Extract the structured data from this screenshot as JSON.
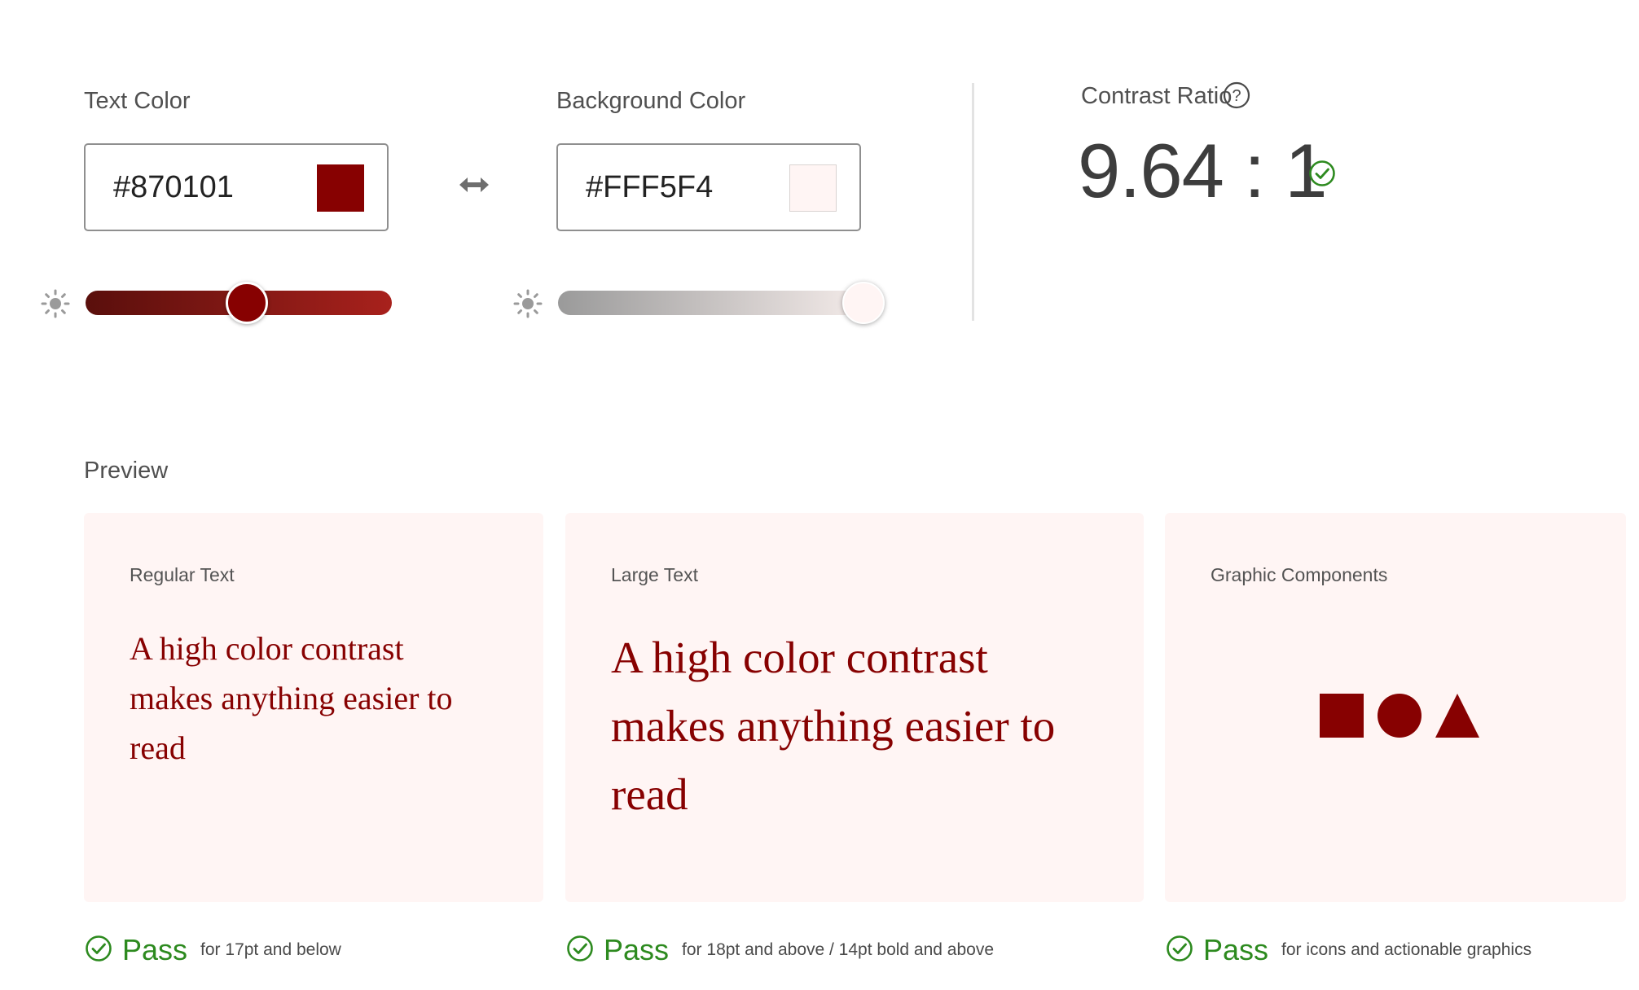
{
  "colors": {
    "text": "#870101",
    "background": "#FFF5F4",
    "pass_green": "#2d8a1f",
    "text_slider_gradient": [
      "#5a0f0c",
      "#a8211c"
    ],
    "bg_slider_gradient": [
      "#9a9a9a",
      "#f7eeec"
    ]
  },
  "text_color": {
    "label": "Text Color",
    "value": "#870101",
    "icon": "brightness-icon",
    "slider_level": 0.53
  },
  "swap": {
    "icon": "swap-arrows-icon"
  },
  "background_color": {
    "label": "Background Color",
    "value": "#FFF5F4",
    "icon": "brightness-icon",
    "slider_level": 1.0
  },
  "contrast": {
    "label": "Contrast Ratio",
    "help_icon": "help-icon",
    "value": "9.64 : 1",
    "status_icon": "check-circle-icon"
  },
  "preview": {
    "heading": "Preview",
    "cards": [
      {
        "label": "Regular Text",
        "sample": "A high color contrast makes anything easier to read",
        "result": "Pass",
        "note": "for 17pt and below"
      },
      {
        "label": "Large Text",
        "sample": "A high color contrast makes anything easier to read",
        "result": "Pass",
        "note": "for 18pt and above / 14pt bold and above"
      },
      {
        "label": "Graphic Components",
        "shapes": [
          "square",
          "circle",
          "triangle"
        ],
        "result": "Pass",
        "note": "for icons and actionable graphics"
      }
    ]
  }
}
